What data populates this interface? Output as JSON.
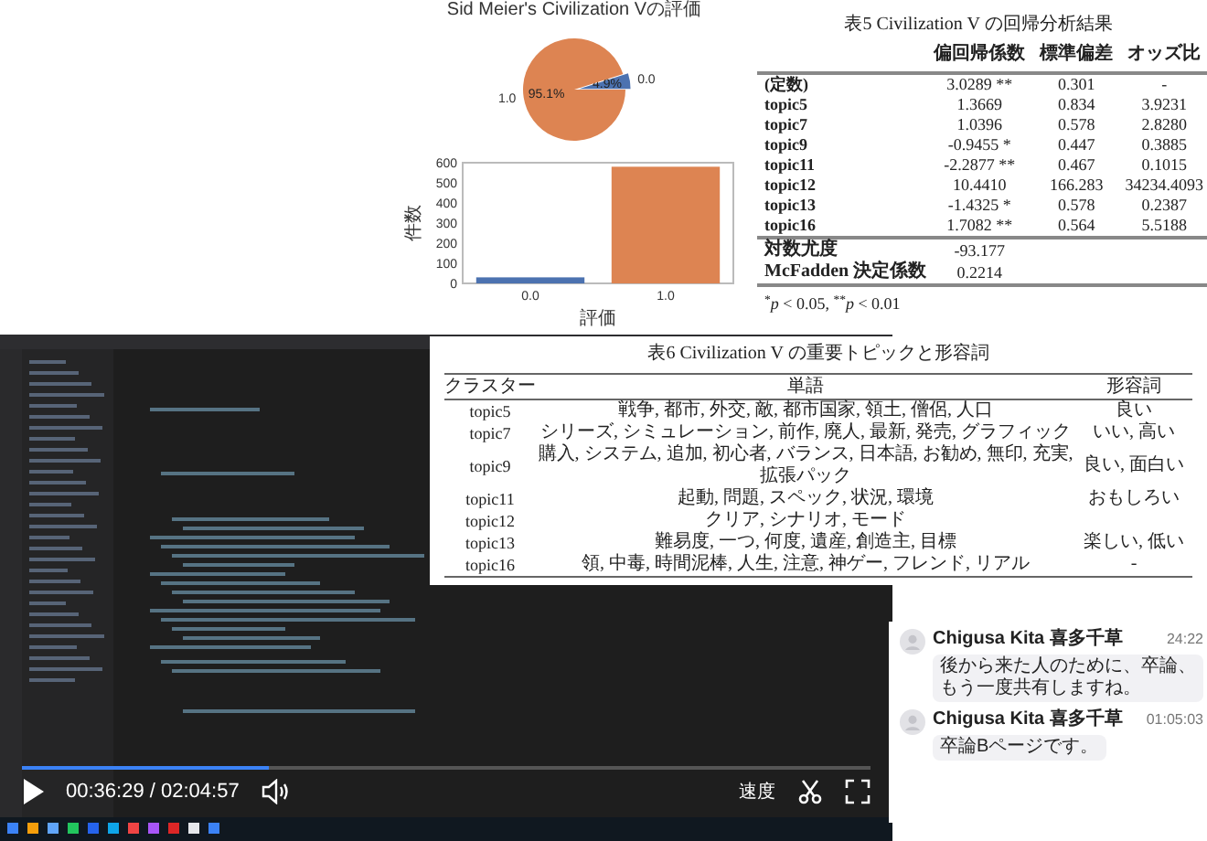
{
  "charts": {
    "pie": {
      "chart_data": {
        "type": "pie",
        "title": "Sid Meier's Civilization Vの評価",
        "categories": [
          "0.0",
          "1.0"
        ],
        "values": [
          4.9,
          95.1
        ],
        "value_labels": [
          "4.9%",
          "95.1%"
        ]
      }
    },
    "bar": {
      "chart_data": {
        "type": "bar",
        "xlabel": "評価",
        "ylabel": "件数",
        "categories": [
          "0.0",
          "1.0"
        ],
        "values": [
          30,
          580
        ],
        "ylim": [
          0,
          600
        ],
        "yticks": [
          0,
          100,
          200,
          300,
          400,
          500,
          600
        ]
      }
    }
  },
  "regression_table": {
    "title": "表5 Civilization V の回帰分析結果",
    "columns": [
      "偏回帰係数",
      "標準偏差",
      "オッズ比"
    ],
    "rows": [
      {
        "label": "(定数)",
        "coef": "3.0289 **",
        "sd": "0.301",
        "odds": "-"
      },
      {
        "label": "topic5",
        "coef": "1.3669",
        "sd": "0.834",
        "odds": "3.9231"
      },
      {
        "label": "topic7",
        "coef": "1.0396",
        "sd": "0.578",
        "odds": "2.8280"
      },
      {
        "label": "topic9",
        "coef": "-0.9455 *",
        "sd": "0.447",
        "odds": "0.3885"
      },
      {
        "label": "topic11",
        "coef": "-2.2877 **",
        "sd": "0.467",
        "odds": "0.1015"
      },
      {
        "label": "topic12",
        "coef": "10.4410",
        "sd": "166.283",
        "odds": "34234.4093"
      },
      {
        "label": "topic13",
        "coef": "-1.4325 *",
        "sd": "0.578",
        "odds": "0.2387"
      },
      {
        "label": "topic16",
        "coef": "1.7082 **",
        "sd": "0.564",
        "odds": "5.5188"
      }
    ],
    "summary_rows": [
      {
        "label": "対数尤度",
        "value": "-93.177"
      },
      {
        "label": "McFadden 決定係数",
        "value": "0.2214"
      }
    ],
    "note": "$^{*}$*p* < 0.05, $^{**}$*p* < 0.01"
  },
  "topics_table": {
    "title": "表6 Civilization V の重要トピックと形容詞",
    "columns": [
      "クラスター",
      "単語",
      "形容詞"
    ],
    "rows": [
      {
        "cluster": "topic5",
        "words": "戦争, 都市, 外交, 敵, 都市国家, 領土, 僧侶, 人口",
        "adjectives": "良い"
      },
      {
        "cluster": "topic7",
        "words": "シリーズ, シミュレーション, 前作, 廃人, 最新, 発売, グラフィック",
        "adjectives": "いい, 高い"
      },
      {
        "cluster": "topic9",
        "words": "購入, システム, 追加, 初心者, バランス, 日本語, お勧め, 無印, 充実, 拡張パック",
        "adjectives": "良い, 面白い"
      },
      {
        "cluster": "topic11",
        "words": "起動, 問題, スペック, 状況, 環境",
        "adjectives": "おもしろい"
      },
      {
        "cluster": "topic12",
        "words": "クリア, シナリオ, モード"
      },
      {
        "cluster": "topic13",
        "words": "難易度, 一つ, 何度, 遺産, 創造主, 目標",
        "adjectives": "楽しい, 低い"
      },
      {
        "cluster": "topic16",
        "words": "領, 中毒, 時間泥棒, 人生, 注意, 神ゲー, フレンド, リアル",
        "adjectives": "-"
      }
    ]
  },
  "chat": {
    "messages": [
      {
        "author": "Chigusa Kita 喜多千草",
        "time": "24:22",
        "text": "後から来た人のために、卒論、もう一度共有しますね。"
      },
      {
        "author": "Chigusa Kita 喜多千草",
        "time": "01:05:03",
        "text": "卒論Bページです。"
      }
    ]
  },
  "video_player": {
    "playing": false,
    "time": "00:36:29 / 02:04:57",
    "progress": {
      "level": 0.29
    },
    "speed_label": "速度"
  }
}
